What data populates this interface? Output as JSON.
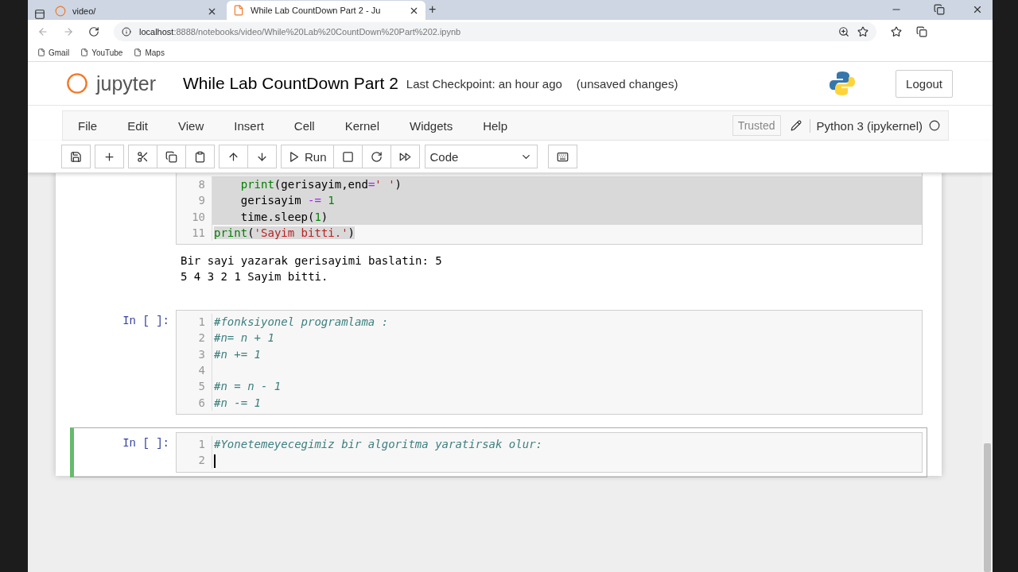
{
  "browser": {
    "tabs": [
      {
        "title": "video/",
        "selected": false,
        "kind": "jupyter"
      },
      {
        "title": "While Lab CountDown Part 2 - Ju",
        "selected": true,
        "kind": "notebook"
      }
    ],
    "new_tab": "+",
    "url_host": "localhost",
    "url_rest": ":8888/notebooks/video/While%20Lab%20CountDown%20Part%202.ipynb",
    "bookmarks": [
      "Gmail",
      "YouTube",
      "Maps"
    ]
  },
  "header": {
    "logo": "jupyter",
    "notebook_title": "While Lab CountDown Part 2",
    "checkpoint": "Last Checkpoint: an hour ago",
    "status": "(unsaved changes)",
    "logout": "Logout"
  },
  "menu": [
    "File",
    "Edit",
    "View",
    "Insert",
    "Cell",
    "Kernel",
    "Widgets",
    "Help"
  ],
  "kernel": {
    "trusted": "Trusted",
    "name": "Python 3 (ipykernel)"
  },
  "toolbar": {
    "run": "Run",
    "cell_type": "Code"
  },
  "cells": [
    {
      "selected": false,
      "lines": [
        {
          "num": "8",
          "selected": true,
          "indented": true,
          "tokens": [
            {
              "kind": "builtin",
              "text": "print"
            },
            {
              "kind": "plain",
              "text": "(gerisayim,end"
            },
            {
              "kind": "op",
              "text": "="
            },
            {
              "kind": "string",
              "text": "' '"
            },
            {
              "kind": "plain",
              "text": ")"
            }
          ]
        },
        {
          "num": "9",
          "selected": true,
          "indented": true,
          "tokens": [
            {
              "kind": "plain",
              "text": "gerisayim "
            },
            {
              "kind": "op",
              "text": "-= "
            },
            {
              "kind": "number",
              "text": "1"
            }
          ]
        },
        {
          "num": "10",
          "selected": true,
          "indented": true,
          "tokens": [
            {
              "kind": "plain",
              "text": "time.sleep("
            },
            {
              "kind": "number",
              "text": "1"
            },
            {
              "kind": "plain",
              "text": ")"
            }
          ]
        },
        {
          "num": "11",
          "selected": false,
          "tokens": [
            {
              "kind": "builtin",
              "text": "print"
            },
            {
              "kind": "plain",
              "text": "("
            },
            {
              "kind": "string",
              "text": "'Sayim bitti.'"
            },
            {
              "kind": "plain",
              "text": ")"
            }
          ]
        }
      ],
      "output": [
        "Bir sayi yazarak gerisayimi baslatin: 5",
        "5 4 3 2 1 Sayim bitti."
      ]
    },
    {
      "prompt": "In [ ]:",
      "selected": false,
      "lines": [
        {
          "num": "1",
          "selected": false,
          "tokens": [
            {
              "kind": "comment",
              "text": "#fonksiyonel programlama :"
            }
          ]
        },
        {
          "num": "2",
          "selected": false,
          "tokens": [
            {
              "kind": "comment",
              "text": "#n= n + 1"
            }
          ]
        },
        {
          "num": "3",
          "selected": false,
          "tokens": [
            {
              "kind": "comment",
              "text": "#n += 1"
            }
          ]
        },
        {
          "num": "4",
          "selected": false
        },
        {
          "num": "5",
          "selected": false,
          "tokens": [
            {
              "kind": "comment",
              "text": "#n = n - 1"
            }
          ]
        },
        {
          "num": "6",
          "selected": false,
          "tokens": [
            {
              "kind": "comment",
              "text": "#n -= 1"
            }
          ]
        }
      ]
    },
    {
      "prompt": "In [ ]:",
      "selected": true,
      "lines": [
        {
          "num": "1",
          "selected": false,
          "tokens": [
            {
              "kind": "comment",
              "text": "#Yonetemeyecegimiz bir algoritma yaratirsak olur:"
            }
          ]
        },
        {
          "num": "2",
          "selected": false,
          "cursor": true
        }
      ]
    }
  ]
}
